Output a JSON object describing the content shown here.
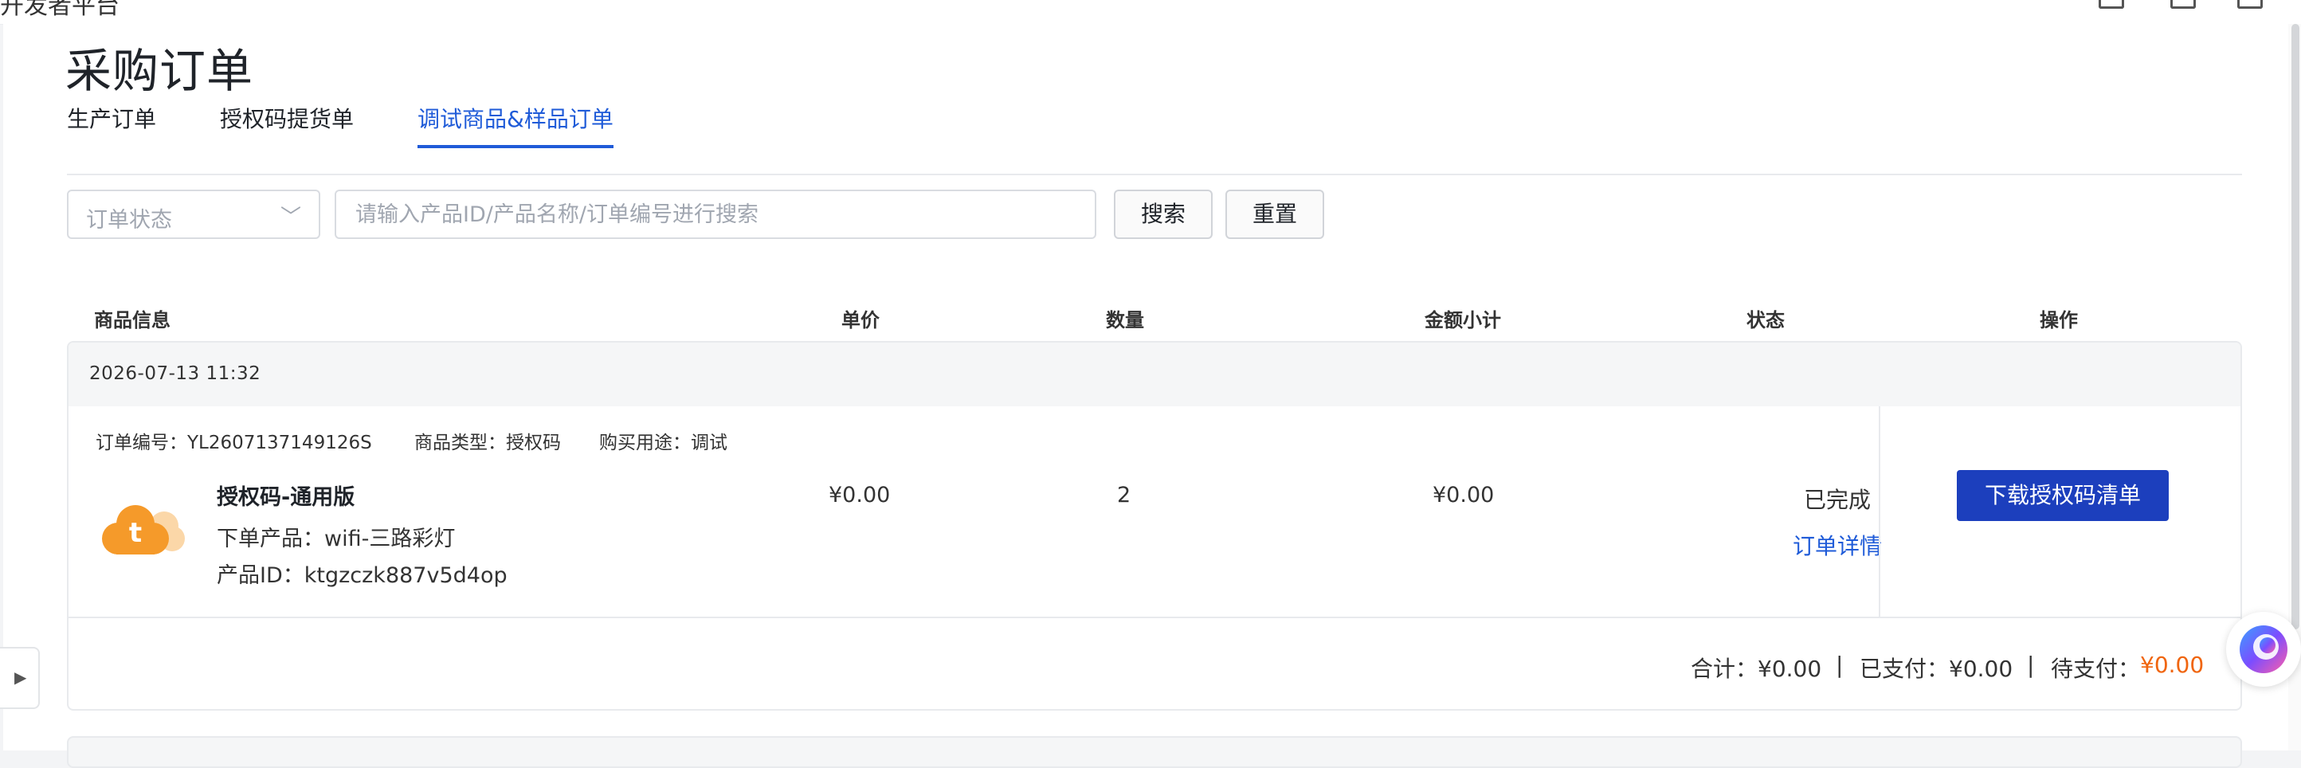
{
  "topbar": {
    "brand": "开发者平台"
  },
  "page": {
    "title": "采购订单"
  },
  "tabs": [
    {
      "label": "生产订单",
      "active": false
    },
    {
      "label": "授权码提货单",
      "active": false
    },
    {
      "label": "调试商品&样品订单",
      "active": true
    }
  ],
  "filters": {
    "status_placeholder": "订单状态",
    "search_placeholder": "请输入产品ID/产品名称/订单编号进行搜索",
    "search_button": "搜索",
    "reset_button": "重置"
  },
  "columns": [
    "商品信息",
    "单价",
    "数量",
    "金额小计",
    "状态",
    "操作"
  ],
  "order": {
    "time": "2026-07-13 11:32",
    "order_no": "订单编号：YL2607137149126S",
    "product_type": "商品类型：授权码",
    "purpose": "购买用途：调试",
    "item": {
      "name": "授权码-通用版",
      "ordered_product": "下单产品：wifi-三路彩灯",
      "product_id": "产品ID：ktgzczk887v5d4op",
      "logo_icon": "tuya-cloud-icon"
    },
    "unit_price": "¥0.00",
    "quantity": "2",
    "subtotal": "¥0.00",
    "status": "已完成",
    "detail_link": "订单详情",
    "action_button": "下载授权码清单",
    "totals": {
      "total": "合计：¥0.00",
      "paid": "已支付：¥0.00",
      "due_label": "待支付：",
      "due_value": "¥0.00"
    }
  },
  "colors": {
    "primary": "#1f5bd8",
    "button_dark": "#1c3fbd",
    "due": "#f0650e",
    "logo": "#f59a2a"
  },
  "icons": {
    "side_toggle": "caret-right-icon",
    "fab": "assistant-orb-icon",
    "select": "chevron-down-icon"
  }
}
